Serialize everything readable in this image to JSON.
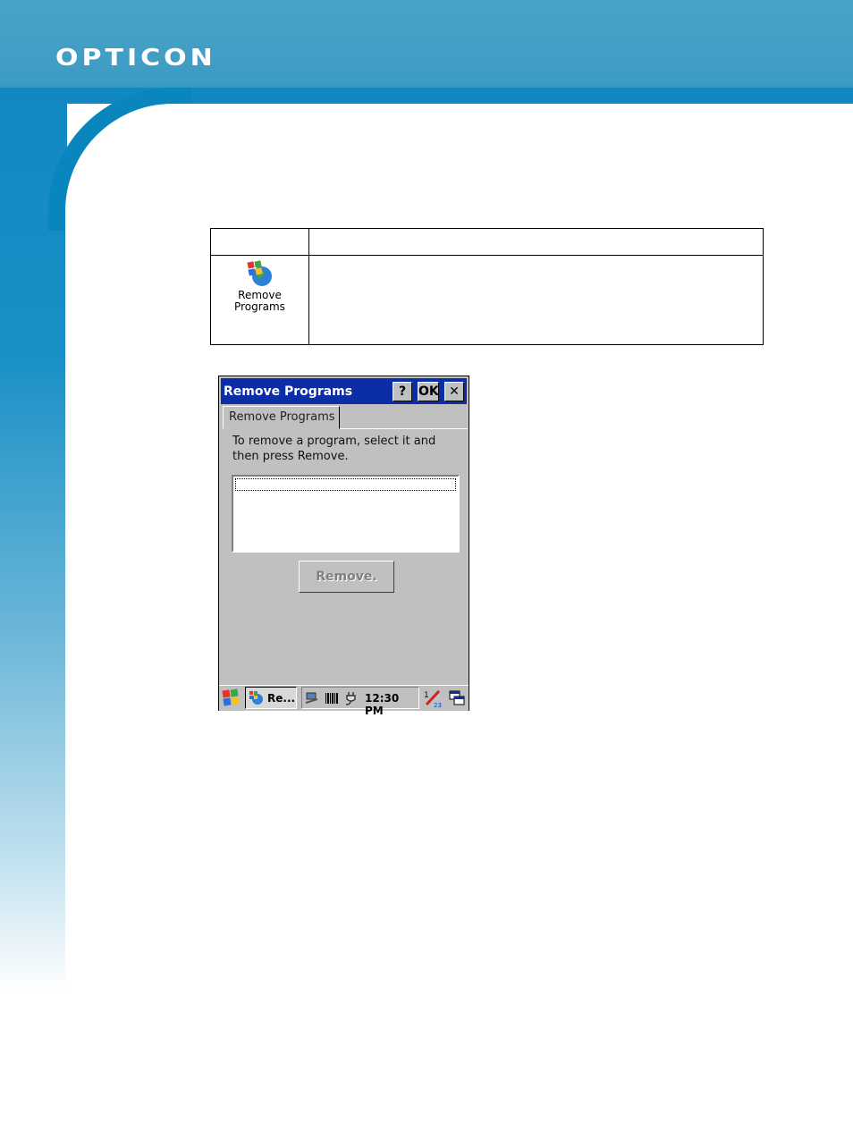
{
  "brand": {
    "logo_text": "OPTICON"
  },
  "table": {
    "header": [
      "",
      ""
    ],
    "rows": [
      {
        "icon": "remove-programs-icon",
        "icon_label": "Remove Programs",
        "description": ""
      }
    ]
  },
  "device": {
    "title": "Remove Programs",
    "help_button": "?",
    "ok_button": "OK",
    "close_button": "✕",
    "tab_label": "Remove Programs",
    "instructions": "To remove a program, select it and then press Remove.",
    "list_items": [],
    "remove_button": "Remove.",
    "taskbar": {
      "task_label": "Re...",
      "clock": "12:30 PM"
    }
  },
  "colors": {
    "brand_blue": "#1188c2",
    "titlebar": "#0b2ea6",
    "dialog_gray": "#c0c0c0"
  }
}
